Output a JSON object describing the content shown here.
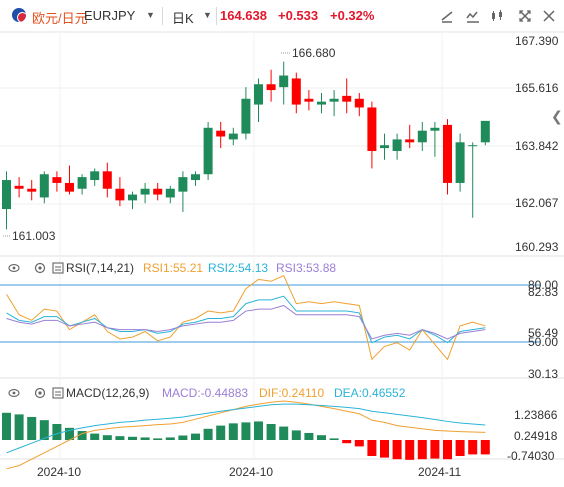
{
  "header": {
    "pair_cn": "欧元/日元",
    "pair_en": "EURJPY",
    "period": "日K",
    "last_price": "164.638",
    "change": "+0.533",
    "change_pct": "+0.32%"
  },
  "colors": {
    "up": "#1f8a5a",
    "down": "#ff0000",
    "price": "#e3162c",
    "accent": "#e3501d",
    "grid": "#e8e8e8",
    "ref": "#3b9ad9"
  },
  "price_axis": [
    "167.390",
    "165.616",
    "163.842",
    "162.067",
    "160.293"
  ],
  "price_annotations": {
    "high": "166.680",
    "low": "161.003"
  },
  "rsi": {
    "title": "RSI(7,14,21)",
    "rsi1": "RSI1:55.21",
    "rsi2": "RSI2:54.13",
    "rsi3": "RSI3:53.88",
    "axis": [
      "80.00",
      "82.83",
      "56.49",
      "50.00",
      "30.13"
    ]
  },
  "macd": {
    "title": "MACD(12,26,9)",
    "macd": "MACD:-0.44883",
    "dif": "DIF:0.24110",
    "dea": "DEA:0.46552",
    "axis": [
      "1.23866",
      "0.24918",
      "-0.74030"
    ]
  },
  "x_axis": [
    "2024-10",
    "2024-10",
    "2024-11"
  ],
  "chart_data": {
    "type": "candlestick",
    "ylim": [
      160.293,
      167.39
    ],
    "candles": [
      [
        161.6,
        162.9,
        160.9,
        162.6
      ],
      [
        162.4,
        162.7,
        162.0,
        162.3
      ],
      [
        162.3,
        162.6,
        161.9,
        162.2
      ],
      [
        162.0,
        162.9,
        161.8,
        162.8
      ],
      [
        162.7,
        162.9,
        162.2,
        162.5
      ],
      [
        162.5,
        163.1,
        162.1,
        162.2
      ],
      [
        162.3,
        162.8,
        162.1,
        162.7
      ],
      [
        162.6,
        163.0,
        162.4,
        162.9
      ],
      [
        162.9,
        163.2,
        162.0,
        162.3
      ],
      [
        162.3,
        162.7,
        161.7,
        161.9
      ],
      [
        161.9,
        162.2,
        161.6,
        162.1
      ],
      [
        162.1,
        162.5,
        161.8,
        162.3
      ],
      [
        162.3,
        162.5,
        161.9,
        162.1
      ],
      [
        162.0,
        162.4,
        161.8,
        162.3
      ],
      [
        162.2,
        162.9,
        161.5,
        162.7
      ],
      [
        162.6,
        162.9,
        162.4,
        162.8
      ],
      [
        162.8,
        164.6,
        162.6,
        164.4
      ],
      [
        164.3,
        164.6,
        163.7,
        164.1
      ],
      [
        164.0,
        164.4,
        163.8,
        164.2
      ],
      [
        164.2,
        165.8,
        164.0,
        165.4
      ],
      [
        165.2,
        166.1,
        164.6,
        165.9
      ],
      [
        165.9,
        166.4,
        165.3,
        165.7
      ],
      [
        165.8,
        166.68,
        165.2,
        166.2
      ],
      [
        166.1,
        166.3,
        164.9,
        165.2
      ],
      [
        165.4,
        165.7,
        165.0,
        165.3
      ],
      [
        165.2,
        165.6,
        164.9,
        165.3
      ],
      [
        165.3,
        165.7,
        164.8,
        165.4
      ],
      [
        165.5,
        166.1,
        164.9,
        165.3
      ],
      [
        165.4,
        165.6,
        164.8,
        165.1
      ],
      [
        165.1,
        165.3,
        163.0,
        163.6
      ],
      [
        163.7,
        164.2,
        163.3,
        163.8
      ],
      [
        163.6,
        164.2,
        163.3,
        164.0
      ],
      [
        164.0,
        164.5,
        163.7,
        163.9
      ],
      [
        163.9,
        164.6,
        163.6,
        164.3
      ],
      [
        164.3,
        164.6,
        163.4,
        164.4
      ],
      [
        164.5,
        164.7,
        162.1,
        162.5
      ],
      [
        162.5,
        164.2,
        162.2,
        163.9
      ],
      [
        163.8,
        163.9,
        161.3,
        163.8
      ],
      [
        163.9,
        164.6,
        163.8,
        164.638
      ]
    ],
    "rsi_series": [
      {
        "name": "RSI1",
        "values": [
          75,
          64,
          61,
          67,
          66,
          56,
          60,
          64,
          55,
          51,
          52,
          55,
          50,
          52,
          60,
          62,
          66,
          65,
          66,
          78,
          83,
          82,
          85,
          70,
          71,
          70,
          71,
          70,
          69,
          40,
          47,
          49,
          45,
          56,
          48,
          40,
          58,
          60,
          58
        ]
      },
      {
        "name": "RSI2",
        "values": [
          65,
          61,
          60,
          63,
          63,
          58,
          60,
          62,
          57,
          55,
          55,
          56,
          54,
          55,
          59,
          60,
          62,
          62,
          63,
          70,
          72,
          72,
          74,
          66,
          66,
          66,
          66,
          66,
          65,
          49,
          52,
          53,
          51,
          56,
          53,
          49,
          55,
          56,
          57
        ]
      },
      {
        "name": "RSI3",
        "values": [
          62,
          60,
          59,
          61,
          61,
          58,
          59,
          60,
          57,
          56,
          56,
          56,
          55,
          56,
          58,
          59,
          60,
          60,
          61,
          66,
          67,
          67,
          69,
          64,
          64,
          64,
          64,
          64,
          63,
          51,
          53,
          54,
          53,
          56,
          54,
          51,
          54,
          55,
          56
        ]
      }
    ],
    "macd_hist": [
      0.85,
      0.8,
      0.72,
      0.62,
      0.5,
      0.38,
      0.28,
      0.2,
      0.15,
      0.12,
      0.1,
      0.08,
      0.05,
      0.08,
      0.14,
      0.2,
      0.35,
      0.45,
      0.52,
      0.55,
      0.58,
      0.5,
      0.42,
      0.3,
      0.22,
      0.15,
      0.05,
      -0.1,
      -0.2,
      -0.5,
      -0.55,
      -0.6,
      -0.62,
      -0.6,
      -0.58,
      -0.6,
      -0.5,
      -0.45,
      -0.45
    ],
    "macd_dif": [
      -0.9,
      -0.8,
      -0.6,
      -0.4,
      -0.2,
      0.0,
      0.2,
      0.3,
      0.35,
      0.4,
      0.42,
      0.45,
      0.48,
      0.5,
      0.55,
      0.65,
      0.75,
      0.85,
      0.95,
      1.05,
      1.12,
      1.18,
      1.22,
      1.18,
      1.12,
      1.05,
      0.98,
      0.9,
      0.82,
      0.62,
      0.55,
      0.45,
      0.4,
      0.35,
      0.3,
      0.28,
      0.26,
      0.25,
      0.24
    ],
    "macd_dea": [
      -0.4,
      -0.25,
      -0.1,
      0.05,
      0.2,
      0.3,
      0.38,
      0.45,
      0.5,
      0.55,
      0.58,
      0.62,
      0.65,
      0.68,
      0.72,
      0.78,
      0.84,
      0.9,
      0.95,
      1.0,
      1.05,
      1.1,
      1.12,
      1.12,
      1.1,
      1.08,
      1.05,
      1.02,
      0.98,
      0.9,
      0.85,
      0.8,
      0.75,
      0.7,
      0.64,
      0.58,
      0.53,
      0.5,
      0.47
    ]
  }
}
